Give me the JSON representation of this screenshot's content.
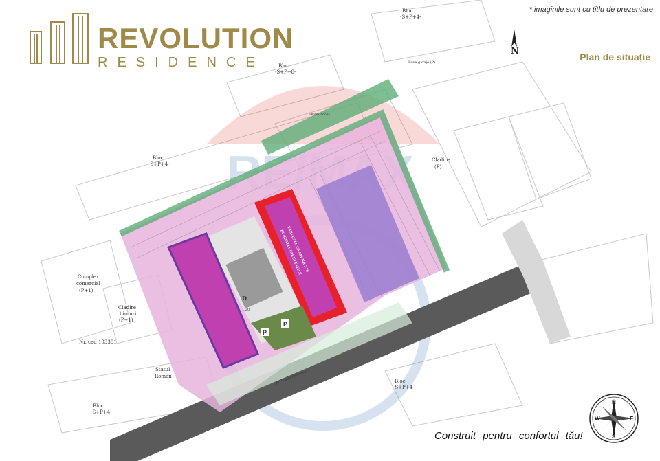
{
  "brand": {
    "title": "REVOLUTION",
    "subtitle": "RESIDENCE"
  },
  "disclaimer": "* imaginile sunt cu titlu de prezentare",
  "plan_title": "Plan de situație",
  "slogan": "Construit pentru confortul tău!",
  "north_label": "N",
  "compass": {
    "n": "N",
    "s": "S",
    "e": "E",
    "w": "W"
  },
  "map_labels": {
    "bloc_top": "Bloc",
    "bloc_top_floors": "-S+P+4-",
    "bloc_mid": "Bloc",
    "bloc_mid_floors": "-S+P+8-",
    "bloc_left": "Bloc",
    "bloc_left_floors": "-S+P+4-",
    "complex": "Complex",
    "complex2": "comercial",
    "complex3": "(P+1)",
    "cladire_birouri": "Cladire",
    "cladire_birouri2": "birouri",
    "cladire_birouri3": "(P+1)",
    "nr_cad": "Nr. cad 103381",
    "statul": "Statul",
    "statul2": "Roman",
    "bloc_bottom_left": "Bloc",
    "bloc_bottom_left_floors": "-S+P+4-",
    "bloc_bottom_right": "Bloc",
    "bloc_bottom_right_floors": "-S+P+4-",
    "cladire_p": "Cladire",
    "cladire_p2": "(P)",
    "drum_acces": "Drum acces",
    "boxe_garaje": "Boxe garaje (P)",
    "street": "Str. Vasile Alecsandri",
    "parking_p": "P",
    "marker_d": "D",
    "building_red_label": "VARIANTA UNAM NR 278",
    "building_red_label2": "FUNDATIA FACULTATILE",
    "m120": "1.20"
  },
  "colors": {
    "brand_gold": "#a08a4a",
    "magenta_building": "#c040b0",
    "red_building": "#e8202a",
    "lavender_building": "#9a7cd0",
    "pink_zone": "#e8b4dc",
    "green_border": "#5fae78",
    "road": "#5a5a5a"
  }
}
